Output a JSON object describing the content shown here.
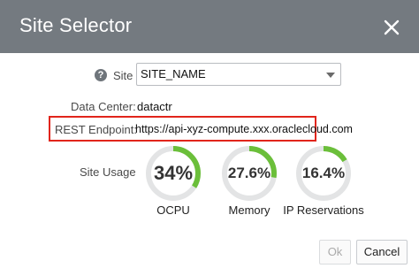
{
  "dialog": {
    "title": "Site Selector"
  },
  "site": {
    "label": "Site",
    "help_glyph": "?",
    "selected_value": "SITE_NAME"
  },
  "data_center": {
    "label": "Data Center:",
    "value": "datactr"
  },
  "rest_endpoint": {
    "label": "REST Endpoint:",
    "value": "https://api-xyz-compute.xxx.oraclecloud.com",
    "highlight_color": "#e1251b"
  },
  "site_usage": {
    "label": "Site Usage",
    "gauges": [
      {
        "name": "OCPU",
        "percent_text": "34%",
        "value": 34
      },
      {
        "name": "Memory",
        "percent_text": "27.6%",
        "value": 27.6
      },
      {
        "name": "IP Reservations",
        "percent_text": "16.4%",
        "value": 16.4
      }
    ],
    "fill_color": "#6bbf3a",
    "track_color": "#e3e4e5"
  },
  "buttons": {
    "ok": "Ok",
    "cancel": "Cancel"
  },
  "colors": {
    "titlebar": "#747a80"
  }
}
